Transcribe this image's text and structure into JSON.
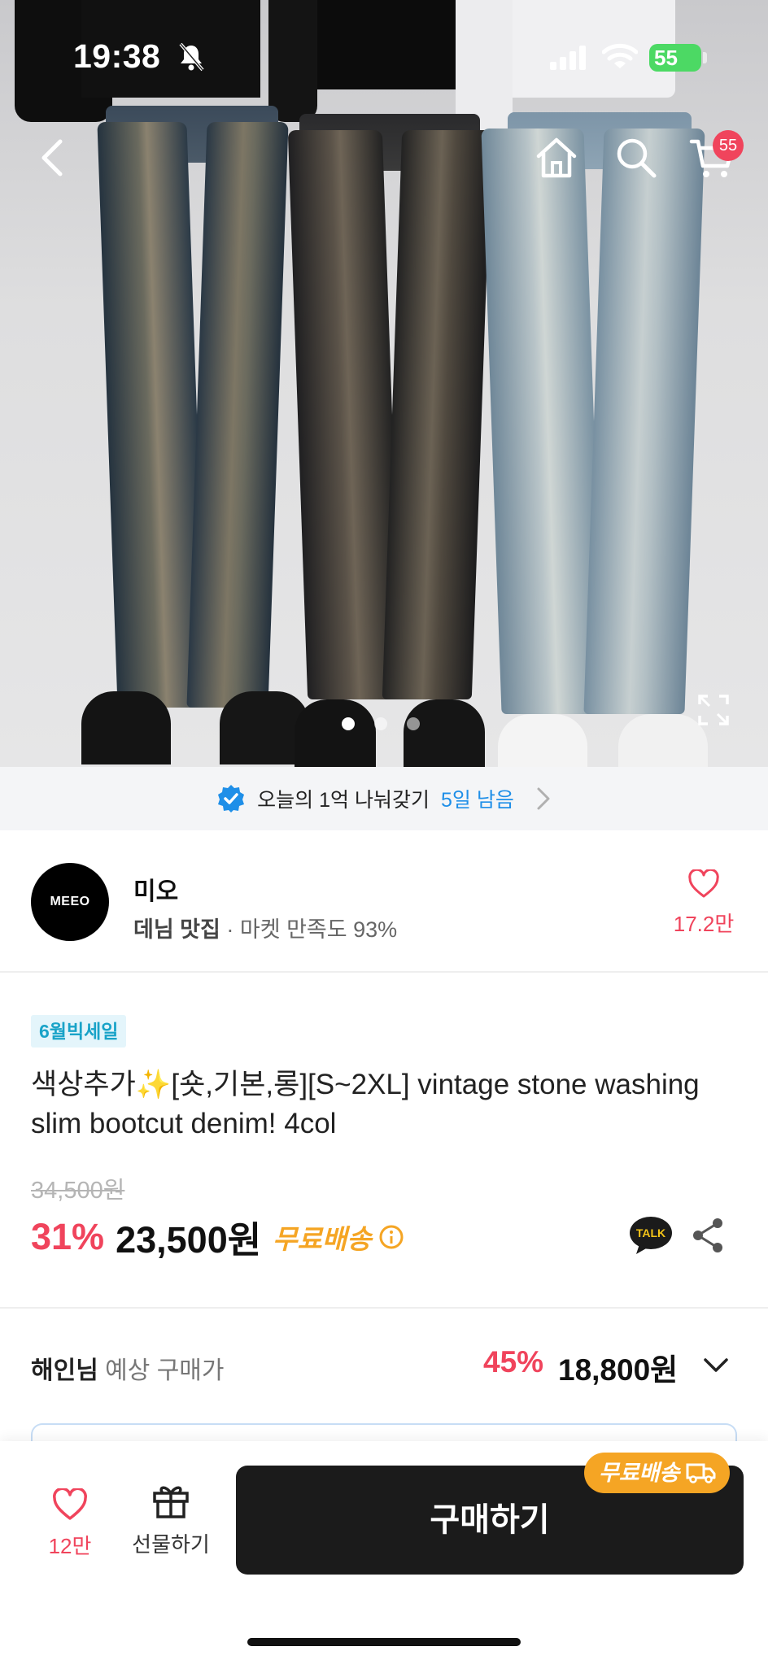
{
  "status_bar": {
    "time": "19:38",
    "battery": "55",
    "icons": [
      "bell-slash-icon",
      "signal-icon",
      "wifi-icon",
      "battery-charging-icon"
    ]
  },
  "nav": {
    "icons": [
      "back-chevron-icon",
      "home-icon",
      "search-icon",
      "cart-icon"
    ],
    "cart_count": "55"
  },
  "gallery": {
    "dots": 3,
    "active_index": 0
  },
  "banner": {
    "text": "오늘의 1억 나눠갖기",
    "highlight": "5일 남음"
  },
  "seller": {
    "logo_text": "MEEO",
    "name": "미오",
    "category": "데님 맛집",
    "satisfaction": "· 마켓 만족도 93%",
    "likes": "17.2만"
  },
  "product": {
    "tag": "6월빅세일",
    "title": "색상추가✨[숏,기본,롱][S~2XL] vintage stone washing slim bootcut denim! 4col",
    "original_price": "34,500원",
    "discount": "31%",
    "price": "23,500원",
    "shipping": "무료배송"
  },
  "expected": {
    "user": "해인님",
    "label": "예상 구매가",
    "discount": "45%",
    "price": "18,800원"
  },
  "bottom_bar": {
    "likes": "12만",
    "gift_label": "선물하기",
    "buy_label": "구매하기",
    "ship_badge": "무료배송"
  },
  "colors": {
    "accent_red": "#f0445c",
    "accent_blue": "#1f8fe8",
    "shipping_orange": "#f5a524",
    "button_dark": "#1b1b1b",
    "tag_bg": "#e4f5fb"
  }
}
